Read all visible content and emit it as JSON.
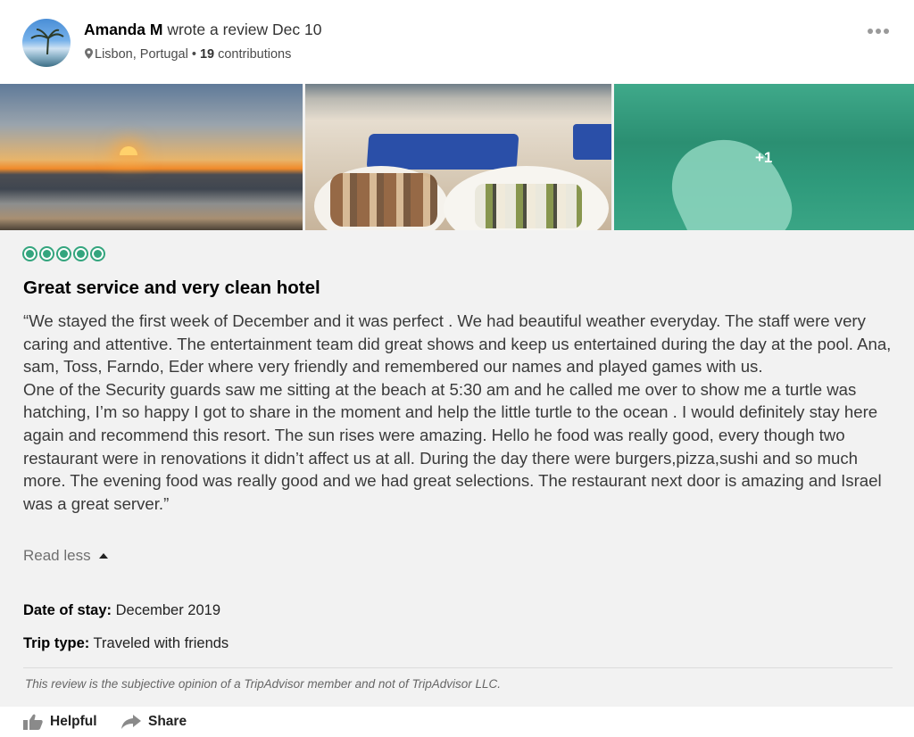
{
  "reviewer": {
    "name": "Amanda M",
    "action": " wrote a review Dec 10",
    "location": "Lisbon, Portugal",
    "separator": " • ",
    "contributions_count": "19",
    "contributions_label": " contributions"
  },
  "photos": {
    "more_count": "+1"
  },
  "rating": {
    "bubbles": 5,
    "max": 5
  },
  "review": {
    "title": "Great service and very clean hotel",
    "paragraph1": "“We stayed the first week of December and it was perfect . We had beautiful weather everyday. The staff were very caring and attentive. The entertainment team did great shows and keep us entertained during the day at the pool. Ana, sam, Toss, Farndo, Eder where very friendly and remembered our names and played games with us.",
    "paragraph2": "One of the Security guards saw me sitting at the beach at 5:30 am and he called me over to show me a turtle was hatching, I’m so happy I got to share in the moment and help the little turtle to the ocean . I would definitely stay here again and recommend this resort. The sun rises were amazing. Hello he food was really good, every though two restaurant were in renovations it didn’t affect us at all. During the day there were burgers,pizza,sushi and so much more. The evening food was really good and we had great selections. The restaurant next door is amazing and Israel was a great server.”",
    "read_less": "Read less"
  },
  "details": {
    "date_label": "Date of stay:",
    "date_value": " December 2019",
    "trip_label": "Trip type:",
    "trip_value": " Traveled with friends"
  },
  "disclaimer": "This review is the subjective opinion of a TripAdvisor member and not of TripAdvisor LLC.",
  "actions": {
    "helpful": "Helpful",
    "share": "Share"
  },
  "colors": {
    "rating_green": "#34a57e",
    "photo_overlay": "#2f9e7e"
  },
  "icons": [
    "map-pin-icon",
    "more-dots-icon",
    "thumbs-up-icon",
    "share-arrow-icon",
    "caret-up-icon"
  ]
}
